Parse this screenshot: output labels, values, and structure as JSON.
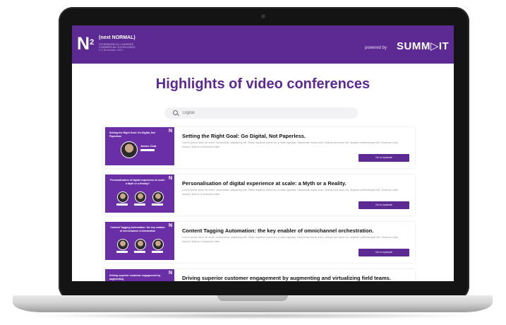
{
  "header": {
    "logo_letter": "N",
    "logo_sup": "2",
    "logo_title": "(next NORMAL)",
    "logo_sub1": "OTHERWORLDLY ASPIRED",
    "logo_sub2": "COMMERCIAL EXCELLENCE",
    "logo_date": "1-3 December 2021",
    "powered_by": "powered by",
    "summit": "SUMM▷IT"
  },
  "page_title": "Highlights of video conferences",
  "search": {
    "value": "Digital",
    "placeholder": "Digital"
  },
  "cards": [
    {
      "title": "Setting the Right Goal: Go Digital, Not Paperless.",
      "thumb_title": "Setting the Right Goal: Go Digital, Not Paperless",
      "thumb_speaker": "James Chat",
      "desc": "Lorem ipsum dolor sit amet, consectetur adipiscing elit. Etiam dapibus luctus leo a vitae egestas. Maecenas turpis enim, finibus sed dolor vel, aliquam pellentesque elit. Vivamus nulla mauris, finibus ut tincidunt vitae.",
      "button": "Go to episode"
    },
    {
      "title": "Personalisation of digital experience at scale: a Myth or a Reality.",
      "thumb_title": "Personalisation of digital experience at scale: a Myth or a Reality?",
      "desc": "Lorem ipsum dolor sit amet, consectetur adipiscing elit. Etiam dapibus luctus leo a vitae egestas. Maecenas turpis enim, finibus sed dolor vel, aliquam pellentesque elit. Vivamus nulla mauris, finibus ut tincidunt vitae.",
      "button": "Go to episode"
    },
    {
      "title": "Content Tagging Automation: the key enabler of omnichannel orchestration.",
      "thumb_title": "Content Tagging Automation: the key enabler of omnichannel orchestration",
      "desc": "Lorem ipsum dolor sit amet, consectetur adipiscing elit. Etiam dapibus luctus leo a vitae egestas. Maecenas turpis enim, finibus sed dolor vel, aliquam pellentesque elit. Vivamus nulla mauris, finibus ut tincidunt vitae.",
      "button": "Go to episode"
    },
    {
      "title": "Driving superior customer engagement by augmenting and virtualizing field teams.",
      "thumb_title": "Driving superior customer engagement by augmenting",
      "desc": "",
      "button": ""
    }
  ],
  "colors": {
    "brand": "#5c2a92",
    "thumb": "#6a2ea6"
  }
}
